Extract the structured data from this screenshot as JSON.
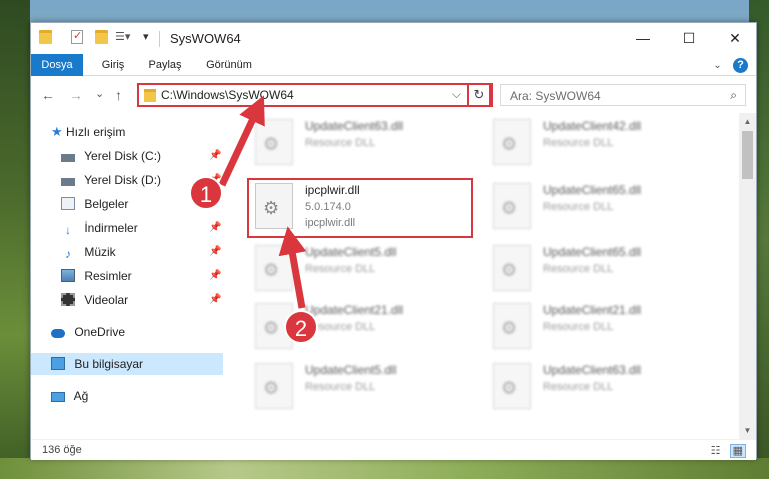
{
  "window": {
    "title": "SysWOW64",
    "minimize": "—",
    "maximize": "☐",
    "close": "✕"
  },
  "ribbon": {
    "tabs": [
      "Dosya",
      "Giriş",
      "Paylaş",
      "Görünüm"
    ],
    "help": "?"
  },
  "address": {
    "path": "C:\\Windows\\SysWOW64",
    "dropdown": "⌵",
    "refresh": "↻",
    "search_placeholder": "Ara: SysWOW64",
    "search_icon": "⌕"
  },
  "nav": {
    "back": "←",
    "forward": "→",
    "recent": "⌄",
    "up": "↑",
    "items": [
      {
        "label": "Hızlı erişim",
        "icon": "star-icon",
        "pinned": false
      },
      {
        "label": "Yerel Disk (C:)",
        "icon": "drive-icon",
        "pinned": true
      },
      {
        "label": "Yerel Disk (D:)",
        "icon": "drive-icon",
        "pinned": true
      },
      {
        "label": "Belgeler",
        "icon": "documents-icon",
        "pinned": true
      },
      {
        "label": "İndirmeler",
        "icon": "download-icon",
        "pinned": true
      },
      {
        "label": "Müzik",
        "icon": "music-icon",
        "pinned": true
      },
      {
        "label": "Resimler",
        "icon": "pictures-icon",
        "pinned": true
      },
      {
        "label": "Videolar",
        "icon": "videos-icon",
        "pinned": true
      },
      {
        "label": "OneDrive",
        "icon": "onedrive-icon",
        "pinned": false
      },
      {
        "label": "Bu bilgisayar",
        "icon": "computer-icon",
        "pinned": false,
        "selected": true
      },
      {
        "label": "Ağ",
        "icon": "network-icon",
        "pinned": false
      }
    ]
  },
  "files": [
    {
      "name": "UpdateClient63.dll",
      "desc": "Resource DLL",
      "blurred": true
    },
    {
      "name": "UpdateClient42.dll",
      "desc": "Resource DLL",
      "blurred": true
    },
    {
      "name": "ipcplwir.dll",
      "desc": "5.0.174.0",
      "desc2": "ipcplwir.dll",
      "blurred": false
    },
    {
      "name": "UpdateClient65.dll",
      "desc": "Resource DLL",
      "blurred": true
    },
    {
      "name": "UpdateClient5.dll",
      "desc": "Resource DLL",
      "blurred": true
    },
    {
      "name": "UpdateClient65.dll",
      "desc": "Resource DLL",
      "blurred": true
    },
    {
      "name": "UpdateClient21.dll",
      "desc": "Resource DLL",
      "blurred": true
    },
    {
      "name": "UpdateClient21.dll",
      "desc": "Resource DLL",
      "blurred": true
    },
    {
      "name": "UpdateClient5.dll",
      "desc": "Resource DLL",
      "blurred": true
    },
    {
      "name": "UpdateClient63.dll",
      "desc": "Resource DLL",
      "blurred": true
    }
  ],
  "status": {
    "count": "136 öğe"
  },
  "annotations": {
    "badge1": "1",
    "badge2": "2",
    "color": "#d9363e"
  }
}
